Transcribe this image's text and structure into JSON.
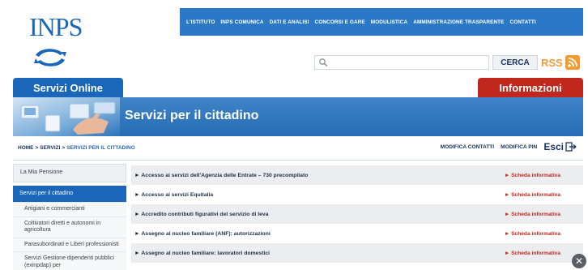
{
  "logo": {
    "text": "INPS"
  },
  "topnav": [
    "L'ISTITUTO",
    "INPS COMUNICA",
    "DATI E ANALISI",
    "CONCORSI E GARE",
    "MODULISTICA",
    "AMMINISTRAZIONE TRASPARENTE",
    "CONTATTI"
  ],
  "search": {
    "value": "",
    "placeholder": "",
    "button_label": "CERCA"
  },
  "rss": {
    "label": "RSS"
  },
  "tabs": {
    "left": "Servizi Online",
    "right": "Informazioni"
  },
  "banner": {
    "title": "Servizi per il cittadino"
  },
  "breadcrumb": {
    "items": [
      "HOME",
      "SERVIZI",
      "SERVIZI PER IL CITTADINO"
    ],
    "separator": ">"
  },
  "actions": {
    "modifica_contatti": "MODIFICA CONTATTI",
    "modifica_pin": "MODIFICA PIN",
    "esci": "Esci"
  },
  "sidebar": {
    "top": "La Mia Pensione",
    "active": "Servizi per il cittadino",
    "items": [
      "Artigiani e commercianti",
      "Coltivatori diretti e autonomi in agricoltura",
      "Parasubordinati e Liberi professionisti",
      "Servizi Gestione dipendenti pubblici (exinpdap) per"
    ]
  },
  "services": [
    {
      "label": "Accesso ai servizi dell'Agenzia delle Entrate – 730 precompilato",
      "link": "Scheda informativa"
    },
    {
      "label": "Accesso ai servizi Equitalia",
      "link": "Scheda informativa"
    },
    {
      "label": "Accredito contributi figurativi del servizio di leva",
      "link": "Scheda informativa"
    },
    {
      "label": "Assegno al nucleo familiare (ANF): autorizzazioni",
      "link": "Scheda informativa"
    },
    {
      "label": "Assegno al nucleo familiare: lavoratori domestici",
      "link": "Scheda informativa"
    }
  ],
  "colors": {
    "primary_blue": "#1a66b8",
    "info_red": "#c1281d",
    "link_red": "#c1281d",
    "rss_orange": "#f29b30"
  }
}
